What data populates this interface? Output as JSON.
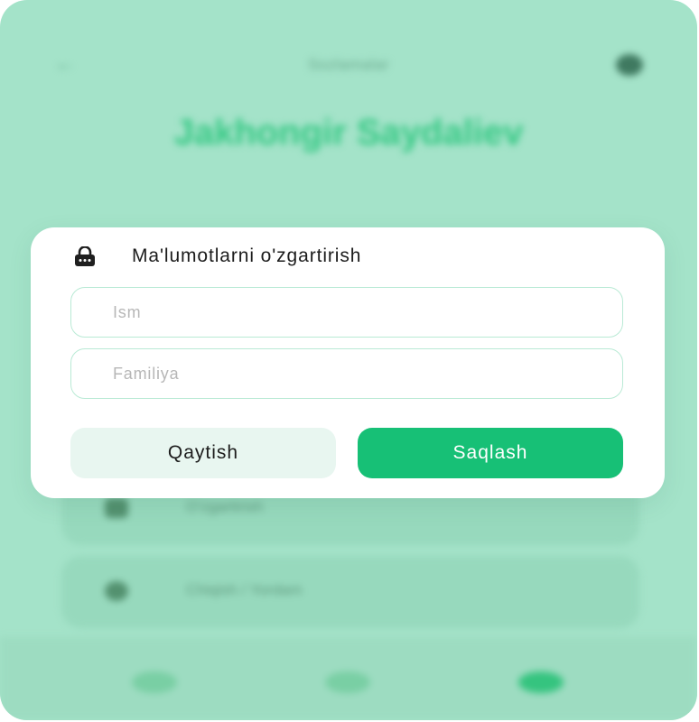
{
  "background": {
    "topbar_title": "Sozlamalar",
    "user_name": "Jakhongir Saydaliev",
    "menu_items": [
      {
        "label": "O'zgartirish"
      },
      {
        "label": "Chiqish / Yordam"
      }
    ]
  },
  "modal": {
    "title": "Ma'lumotlarni o'zgartirish",
    "icon": "lock-icon",
    "fields": {
      "name": {
        "placeholder": "Ism",
        "value": ""
      },
      "surname": {
        "placeholder": "Familiya",
        "value": ""
      }
    },
    "buttons": {
      "back": "Qaytish",
      "save": "Saqlash"
    }
  },
  "colors": {
    "accent": "#17c076",
    "backdrop": "#a4e3c9",
    "field_border": "#b9ead5",
    "secondary_button": "#e8f6f0"
  }
}
